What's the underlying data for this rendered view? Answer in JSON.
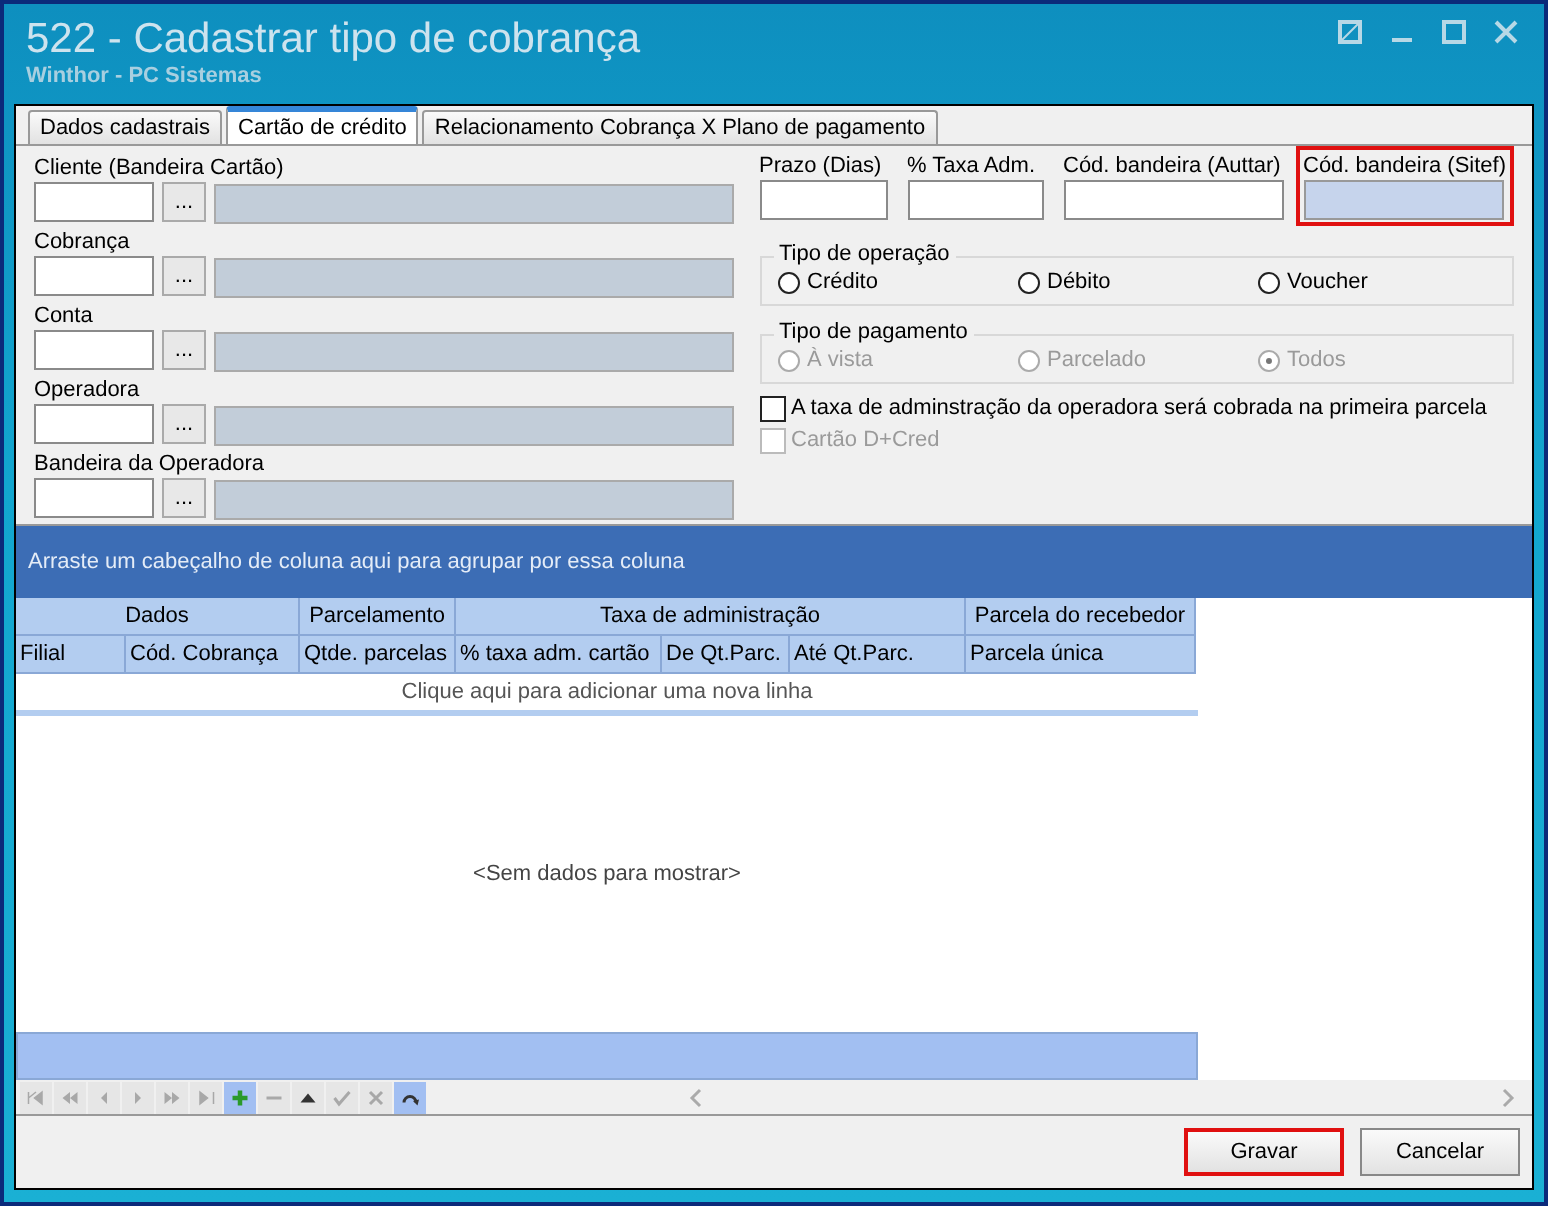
{
  "window": {
    "title": "522 - Cadastrar tipo de cobrança",
    "subtitle": "Winthor - PC Sistemas"
  },
  "tabs": [
    {
      "label": "Dados cadastrais",
      "selected": false
    },
    {
      "label": "Cartão de crédito",
      "selected": true
    },
    {
      "label": "Relacionamento Cobrança X Plano de pagamento",
      "selected": false
    }
  ],
  "lookups": [
    {
      "label": "Cliente (Bandeira Cartão)",
      "button": "..."
    },
    {
      "label": "Cobrança",
      "button": "..."
    },
    {
      "label": "Conta",
      "button": "..."
    },
    {
      "label": "Operadora",
      "button": "..."
    },
    {
      "label": "Bandeira da Operadora",
      "button": "..."
    }
  ],
  "fields": [
    {
      "label": "Prazo (Dias)",
      "disabled": false,
      "highlighted": false
    },
    {
      "label": "% Taxa Adm.",
      "disabled": false,
      "highlighted": false
    },
    {
      "label": "Cód. bandeira (Auttar)",
      "disabled": false,
      "highlighted": false
    },
    {
      "label": "Cód. bandeira (Sitef)",
      "disabled": true,
      "highlighted": true
    }
  ],
  "radio_groups": [
    {
      "title": "Tipo de operação",
      "disabled": false,
      "options": [
        {
          "label": "Crédito",
          "selected": false
        },
        {
          "label": "Débito",
          "selected": false
        },
        {
          "label": "Voucher",
          "selected": false
        }
      ]
    },
    {
      "title": "Tipo de pagamento",
      "disabled": true,
      "options": [
        {
          "label": "À vista",
          "selected": false
        },
        {
          "label": "Parcelado",
          "selected": false
        },
        {
          "label": "Todos",
          "selected": true
        }
      ]
    }
  ],
  "checkboxes": [
    {
      "label": "A taxa de adminstração da operadora será cobrada na primeira parcela",
      "checked": false,
      "disabled": false
    },
    {
      "label": "Cartão D+Cred",
      "checked": false,
      "disabled": true
    }
  ],
  "grid": {
    "group_panel": "Arraste um cabeçalho de coluna aqui para agrupar por essa coluna",
    "bands": [
      {
        "label": "Dados",
        "columns": [
          "Filial",
          "Cód. Cobrança"
        ]
      },
      {
        "label": "Parcelamento",
        "columns": [
          "Qtde. parcelas"
        ]
      },
      {
        "label": "Taxa de administração",
        "columns": [
          "% taxa adm. cartão",
          "De Qt.Parc.",
          "Até Qt.Parc."
        ]
      },
      {
        "label": "Parcela do recebedor",
        "columns": [
          "Parcela única"
        ]
      }
    ],
    "new_row": "Clique aqui para adicionar uma nova linha",
    "empty": "<Sem dados para mostrar>"
  },
  "buttons": [
    {
      "label": "Gravar",
      "highlighted": true
    },
    {
      "label": "Cancelar",
      "highlighted": false
    }
  ]
}
